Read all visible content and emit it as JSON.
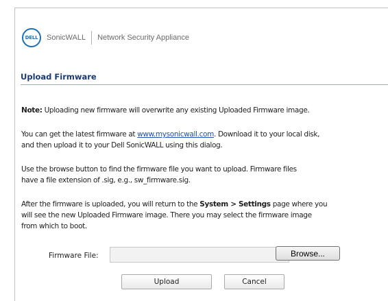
{
  "header": {
    "logo_text": "DELL",
    "brand": "SonicWALL",
    "product": "Network Security Appliance"
  },
  "section_title": "Upload Firmware",
  "paragraphs": {
    "note_label": "Note:",
    "note_text": " Uploading new firmware will overwrite any existing Uploaded Firmware image.",
    "p2_before": "You can get the latest firmware at ",
    "p2_link": "www.mysonicwall.com",
    "p2_after_line1": ". Download it to your local disk,",
    "p2_line2": "and then upload it to your Dell SonicWALL using this dialog.",
    "p3_line1": "Use the browse button to find the firmware file you want to upload. Firmware files",
    "p3_line2": "have a file extension of .sig, e.g., sw_firmware.sig.",
    "p4_before": "After the firmware is uploaded, you will return to the ",
    "p4_bold": "System > Settings",
    "p4_after": " page where you",
    "p4_line2": "will see the new Uploaded Firmware image. There you may select the firmware image",
    "p4_line3": "from which to boot."
  },
  "form": {
    "file_label": "Firmware File:",
    "file_value": "",
    "browse_label": "Browse...",
    "upload_label": "Upload",
    "cancel_label": "Cancel"
  }
}
